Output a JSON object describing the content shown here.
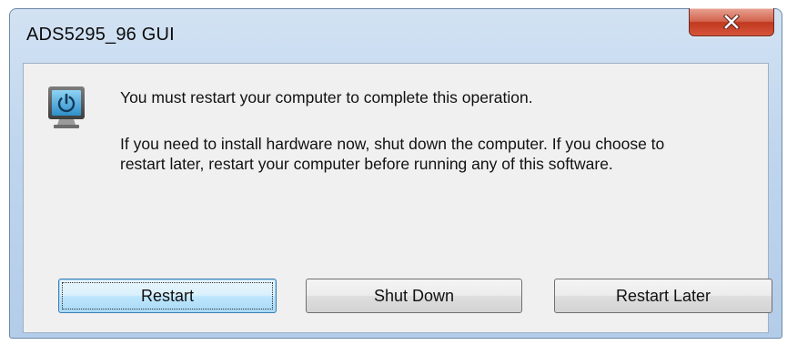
{
  "window": {
    "title": "ADS5295_96 GUI",
    "close_icon": "close-icon"
  },
  "dialog": {
    "icon": "restart-computer-icon",
    "message": "You must restart your computer to complete this operation.",
    "detail": "If you need to install hardware now, shut down the computer. If you choose to restart later, restart your computer before running any of this software."
  },
  "buttons": {
    "restart": "Restart",
    "shut_down": "Shut Down",
    "restart_later": "Restart Later"
  },
  "colors": {
    "frame": "#bed5ed",
    "close_button": "#c0391f",
    "client_bg": "#f0f0f0",
    "default_button": "#bee6fd"
  }
}
